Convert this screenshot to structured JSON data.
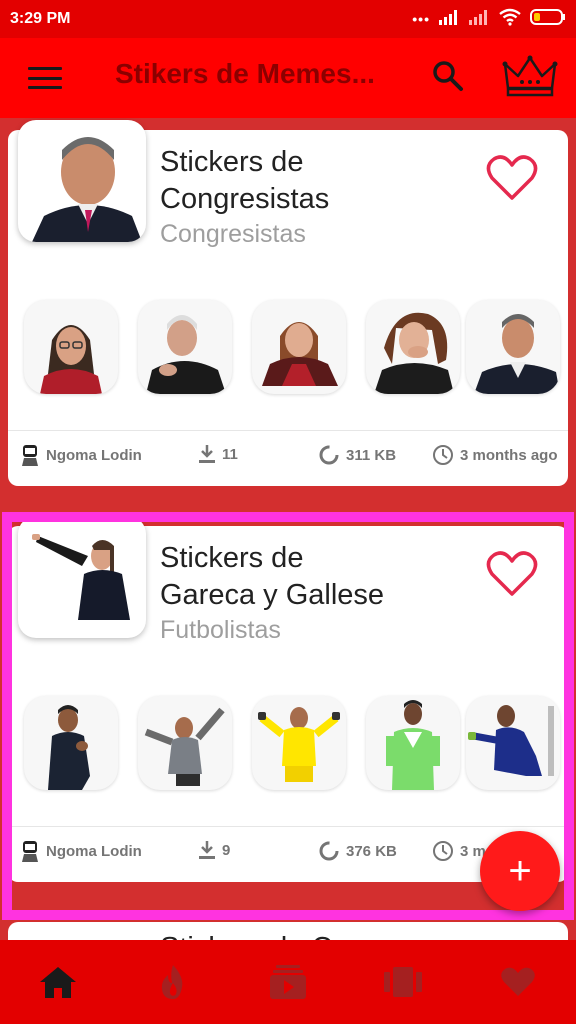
{
  "status_bar": {
    "time": "3:29 PM",
    "dots": "•••"
  },
  "app_bar": {
    "title": "Stikers de Memes..."
  },
  "packs": [
    {
      "title_line1": "Stickers de",
      "title_line2": "Congresistas",
      "category": "Congresistas",
      "author": "Ngoma Lodin",
      "downloads": "11",
      "size": "311 KB",
      "updated": "3 months ago",
      "favorite": false
    },
    {
      "title_line1": "Stickers de",
      "title_line2": "Gareca y Gallese",
      "category": "Futbolistas",
      "author": "Ngoma Lodin",
      "downloads": "9",
      "size": "376 KB",
      "updated": "3 m",
      "favorite": false
    },
    {
      "title_line1": "Stickers de Cueva"
    }
  ],
  "fab": {
    "label": "+"
  },
  "bottom_nav": {
    "items": [
      "home-icon",
      "fire-icon",
      "video-icon",
      "carousel-icon",
      "heart-icon"
    ],
    "active": "home-icon"
  },
  "colors": {
    "status_bar": "#e30000",
    "app_bar": "#ff0000",
    "background": "#d32f2f",
    "title_text": "#8b0000",
    "accent": "#e5294e",
    "highlight": "#ff33e0"
  }
}
